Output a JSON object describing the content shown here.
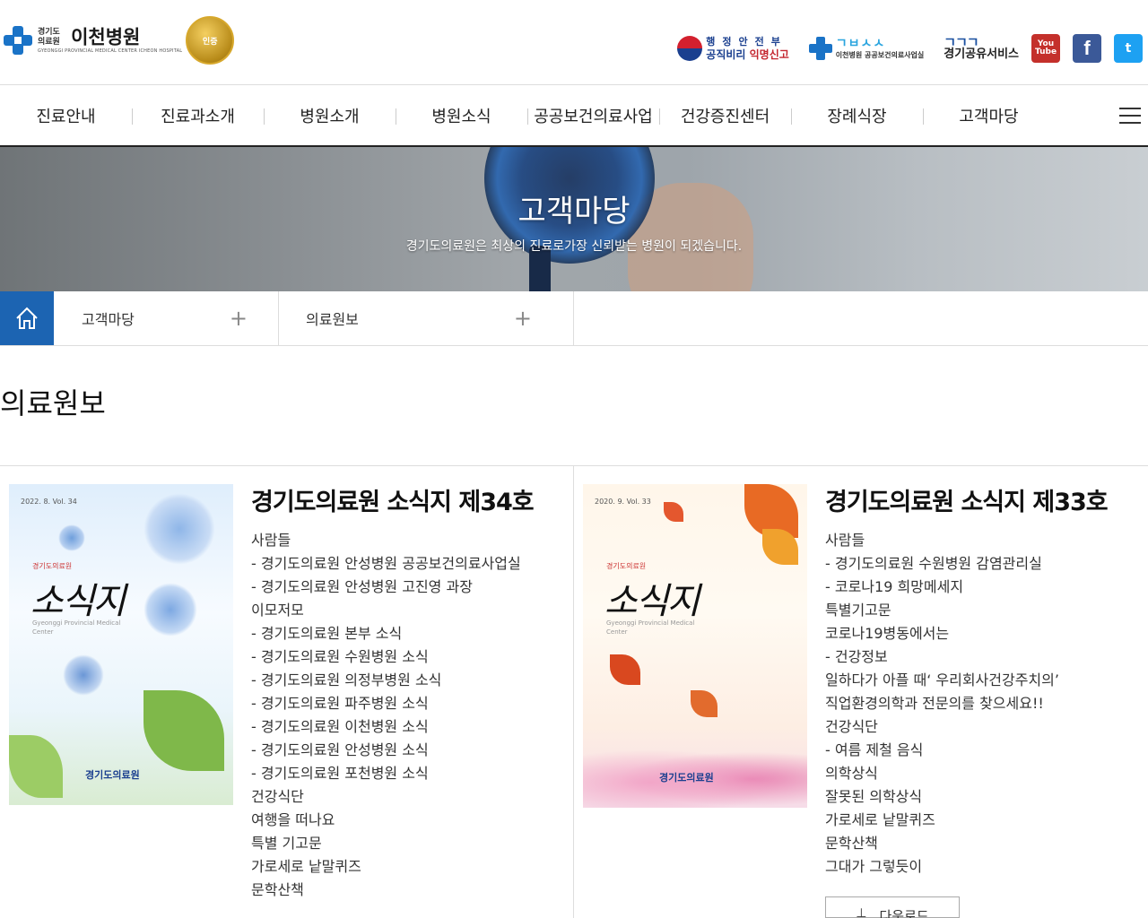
{
  "header": {
    "logo_small": "경기도 의료원",
    "logo_name": "이천병원",
    "logo_eng": "GYEONGGI PROVINCIAL MEDICAL CENTER ICHEON HOSPITAL",
    "badge_text": "인증",
    "util": {
      "gov_top": "행정안전부",
      "gov_bottom_a": "공직비리 ",
      "gov_bottom_b": "익명신고",
      "health_wave": "ㄱㅂㅅㅅ",
      "health_text": "이천병원 공공보건의료사업실",
      "share_top": "ㄱㄱㄱ",
      "share_bottom": "경기공유서비스",
      "youtube": "You Tube",
      "facebook": "f",
      "twitter": "t"
    }
  },
  "nav": {
    "items": [
      "진료안내",
      "진료과소개",
      "병원소개",
      "병원소식",
      "공공보건의료사업",
      "건강증진센터",
      "장례식장",
      "고객마당"
    ]
  },
  "banner": {
    "title": "고객마당",
    "subtitle": "경기도의료원은 최상의 진료로가장 신뢰받는 병원이 되겠습니다."
  },
  "location": {
    "level1": "고객마당",
    "level2": "의료원보"
  },
  "page_title": "의료원보",
  "cards": [
    {
      "title": "경기도의료원 소식지 제34호",
      "cover_vol": "2022. 8. Vol. 34",
      "cover_hosp": "경기도의료원",
      "cover_title": "소식지",
      "cover_eng": "Gyeonggi Provincial Medical Center",
      "cover_foot": "경기도의료원",
      "items": [
        "사람들",
        "- 경기도의료원 안성병원 공공보건의료사업실",
        "- 경기도의료원 안성병원 고진영 과장",
        "이모저모",
        "- 경기도의료원 본부 소식",
        "- 경기도의료원 수원병원 소식",
        "- 경기도의료원 의정부병원 소식",
        "- 경기도의료원 파주병원 소식",
        "- 경기도의료원 이천병원 소식",
        "- 경기도의료원 안성병원 소식",
        "- 경기도의료원 포천병원 소식",
        "건강식단",
        "여행을 떠나요",
        "특별 기고문",
        "가로세로 낱말퀴즈",
        "문학산책"
      ]
    },
    {
      "title": "경기도의료원 소식지 제33호",
      "cover_vol": "2020. 9. Vol. 33",
      "cover_hosp": "경기도의료원",
      "cover_title": "소식지",
      "cover_eng": "Gyeonggi Provincial Medical Center",
      "cover_foot": "경기도의료원",
      "items": [
        "사람들",
        "- 경기도의료원 수원병원 감염관리실",
        "- 코로나19 희망메세지",
        "특별기고문",
        " 코로나19병동에서는",
        "- 건강정보",
        "일하다가 아플 때‘ 우리회사건강주치의’",
        "직업환경의학과 전문의를 찾으세요!!",
        "건강식단",
        "- 여름 제철 음식",
        "의학상식",
        "잘못된 의학상식",
        "가로세로 낱말퀴즈",
        "문학산책",
        "그대가 그렇듯이"
      ],
      "download_label": "다운로드"
    }
  ],
  "colors": {
    "brand_blue": "#1c64b2",
    "nav_border": "#222222"
  }
}
